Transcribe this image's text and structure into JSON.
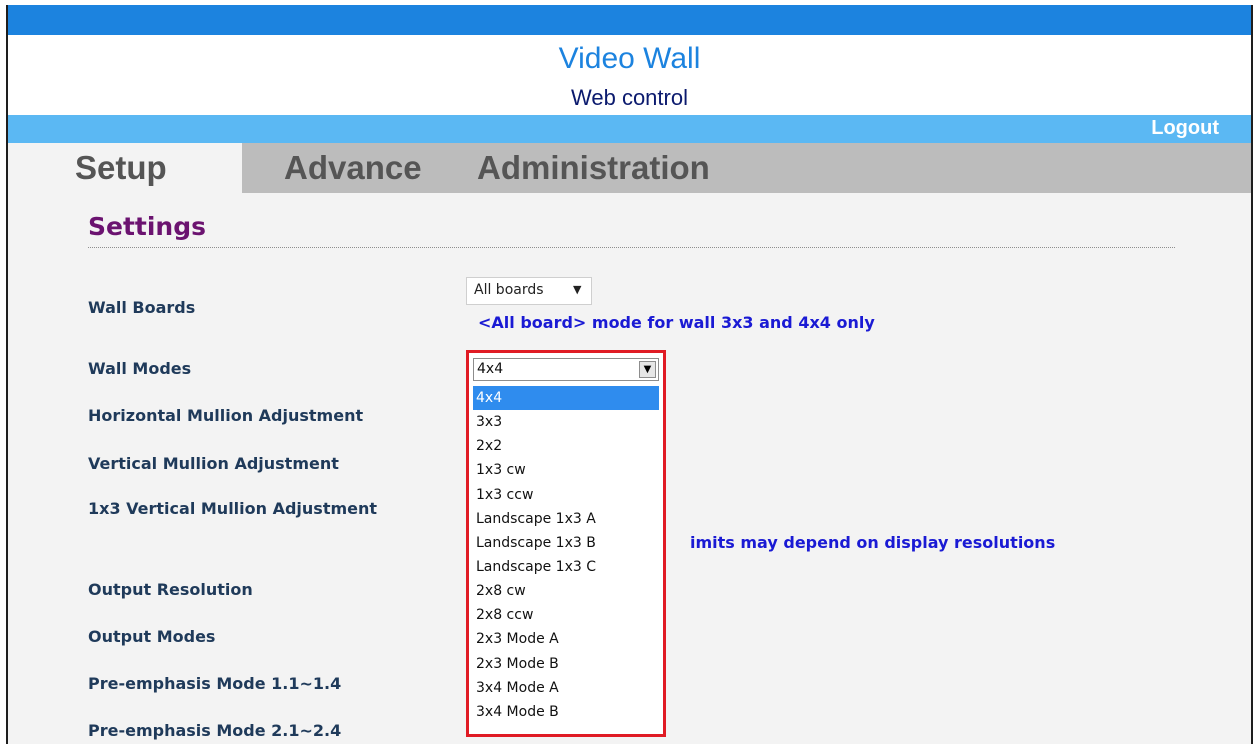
{
  "header": {
    "title": "Video Wall",
    "subtitle": "Web control",
    "logout_label": "Logout"
  },
  "tabs": [
    {
      "label": "Setup"
    },
    {
      "label": "Advance"
    },
    {
      "label": "Administration"
    }
  ],
  "settings": {
    "section_title": "Settings",
    "wall_boards": {
      "label": "Wall Boards",
      "value": "All boards",
      "note": "<All board> mode for wall 3x3 and 4x4 only"
    },
    "wall_modes": {
      "label": "Wall Modes",
      "value": "4x4",
      "options": [
        "4x4",
        "3x3",
        "2x2",
        "1x3 cw",
        "1x3 ccw",
        "Landscape 1x3 A",
        "Landscape 1x3 B",
        "Landscape 1x3 C",
        "2x8 cw",
        "2x8 ccw",
        "2x3 Mode A",
        "2x3 Mode B",
        "3x4 Mode A",
        "3x4 Mode B"
      ],
      "selected_index": 0
    },
    "limits_note": "imits may depend on display resolutions",
    "labels": {
      "horizontal_mullion": "Horizontal Mullion Adjustment",
      "vertical_mullion": "Vertical Mullion Adjustment",
      "vertical_mullion_1x3": "1x3 Vertical Mullion Adjustment",
      "output_resolution": "Output Resolution",
      "output_modes": "Output Modes",
      "preemphasis_1": "Pre-emphasis Mode 1.1~1.4",
      "preemphasis_2": "Pre-emphasis Mode 2.1~2.4"
    }
  },
  "colors": {
    "top_bar": "#1c83df",
    "logout_bar": "#5bb8f3",
    "tab_bar": "#bcbcbc",
    "section_title": "#6b1370",
    "note_text": "#1a1ad4",
    "highlight_box": "#e01b24",
    "selected_option": "#2f8cee"
  },
  "icons": {
    "wall_boards_caret": "caret-down-icon",
    "wall_modes_arrow": "dropdown-arrow-icon"
  }
}
